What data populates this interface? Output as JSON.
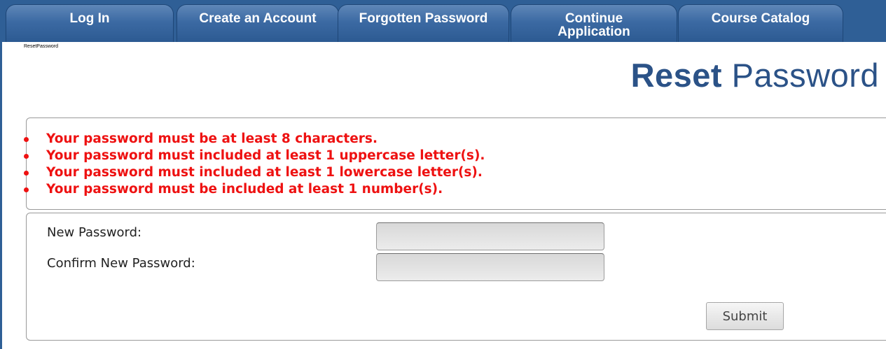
{
  "nav": {
    "tabs": {
      "login": "Log In",
      "create": "Create an Account",
      "forgot": "Forgotten Password",
      "continue_line1": "Continue",
      "continue_line2": "Application",
      "catalog": "Course Catalog"
    }
  },
  "breadcrumb": "ResetPassword",
  "title": {
    "bold": "Reset",
    "rest": " Password"
  },
  "errors": [
    "Your password must be at least 8 characters.",
    "Your password must included at least 1 uppercase letter(s).",
    "Your password must included at least 1 lowercase letter(s).",
    "Your password must be included at least 1 number(s)."
  ],
  "form": {
    "new_password_label": "New Password:",
    "new_password_value": "",
    "confirm_password_label": "Confirm New Password:",
    "confirm_password_value": "",
    "submit_label": "Submit"
  },
  "colors": {
    "nav_bar": "#2f5f96",
    "title": "#2b5287",
    "error": "#ee1111"
  }
}
